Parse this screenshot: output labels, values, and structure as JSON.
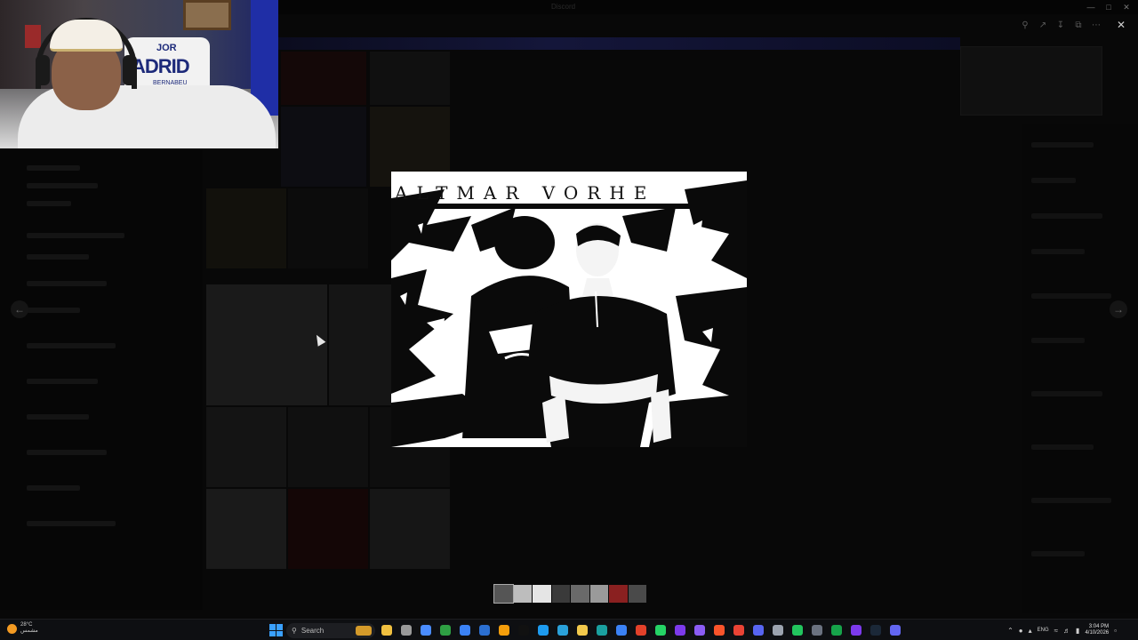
{
  "app": {
    "title": "Discord"
  },
  "webcam": {
    "jersey_text": "ADRID",
    "jersey_sub": "JOR",
    "jersey_sub2": "BERNABEU"
  },
  "viewer": {
    "image_caption": "ALTMAR VORHE",
    "toolbar_icons": [
      "zoom-icon",
      "forward-icon",
      "download-icon",
      "open-external-icon",
      "more-icon"
    ],
    "close_icon": "close-icon",
    "prev_icon": "←",
    "next_icon": "→",
    "filmstrip_count": 8,
    "active_index": 0
  },
  "taskbar": {
    "weather_temp": "28°C",
    "weather_desc": "مشمس",
    "search_placeholder": "Search",
    "lang": "ENG",
    "time": "3:04 PM",
    "date": "4/10/2026",
    "apps": [
      {
        "name": "file-explorer-icon",
        "color": "#f0c040"
      },
      {
        "name": "task-view-icon",
        "color": "#9a9a9a"
      },
      {
        "name": "copilot-icon",
        "color": "#4a8cff"
      },
      {
        "name": "sheets-icon",
        "color": "#2ea043"
      },
      {
        "name": "calendar-icon",
        "color": "#3b82f6"
      },
      {
        "name": "shield-icon",
        "color": "#2b6fd1"
      },
      {
        "name": "chrome-orange-icon",
        "color": "#f59e0b"
      },
      {
        "name": "tiktok-icon",
        "color": "#111111"
      },
      {
        "name": "twitter-icon",
        "color": "#1d9bf0"
      },
      {
        "name": "telegram-icon",
        "color": "#2aa1da"
      },
      {
        "name": "folder-icon",
        "color": "#f2c94c"
      },
      {
        "name": "edge-icon",
        "color": "#1aa0a0"
      },
      {
        "name": "store-icon",
        "color": "#3b82f6"
      },
      {
        "name": "autocad-icon",
        "color": "#e3412a"
      },
      {
        "name": "whatsapp-icon",
        "color": "#25d366"
      },
      {
        "name": "app-purple-icon",
        "color": "#7c3aed"
      },
      {
        "name": "app-purple2-icon",
        "color": "#8b5cf6"
      },
      {
        "name": "brave-icon",
        "color": "#fb542b"
      },
      {
        "name": "chrome-icon",
        "color": "#ea4335"
      },
      {
        "name": "discord-icon",
        "color": "#5865f2"
      },
      {
        "name": "settings-icon",
        "color": "#9ca3af"
      },
      {
        "name": "xbox-icon",
        "color": "#22c55e"
      },
      {
        "name": "code-icon",
        "color": "#6b7280"
      },
      {
        "name": "excel-icon",
        "color": "#16a34a"
      },
      {
        "name": "app-violet-icon",
        "color": "#7c3aed"
      },
      {
        "name": "steam-icon",
        "color": "#1b2838"
      },
      {
        "name": "vpn-icon",
        "color": "#6366f1"
      }
    ]
  }
}
